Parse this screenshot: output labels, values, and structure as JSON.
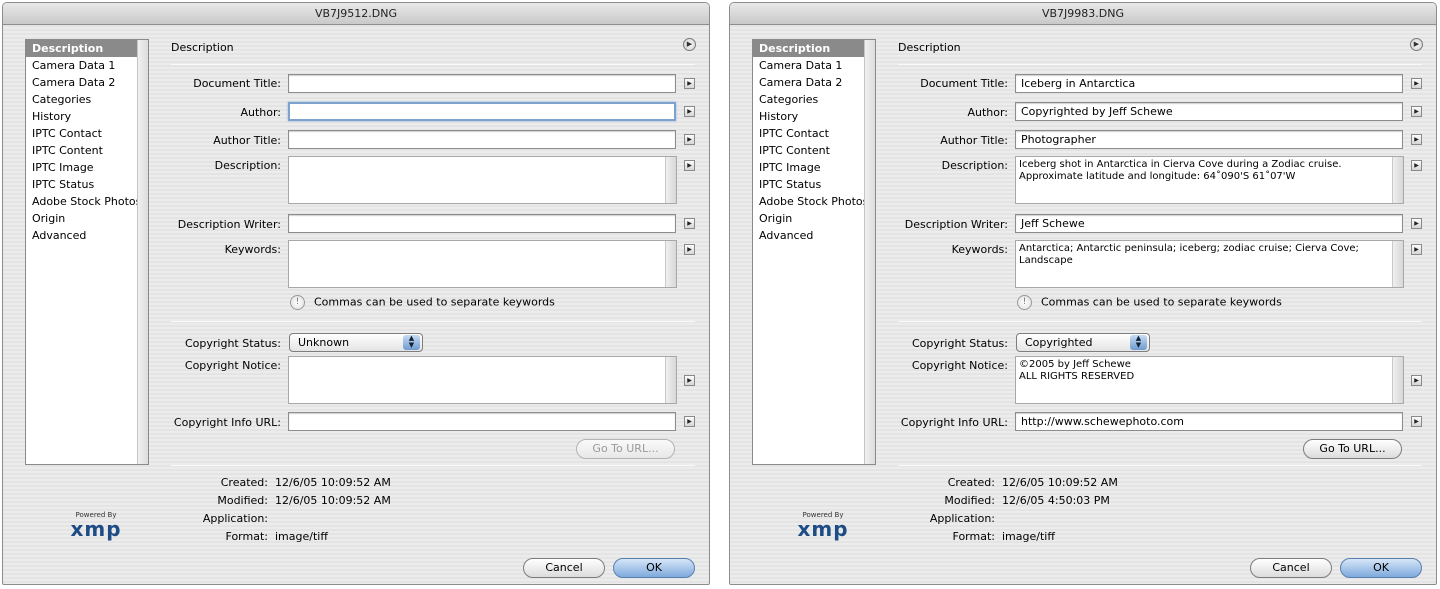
{
  "windows": [
    {
      "title": "VB7J9512.DNG",
      "sidebar": [
        "Description",
        "Camera Data 1",
        "Camera Data 2",
        "Categories",
        "History",
        "IPTC Contact",
        "IPTC Content",
        "IPTC Image",
        "IPTC Status",
        "Adobe Stock Photos",
        "Origin",
        "Advanced"
      ],
      "panel_title": "Description",
      "labels": {
        "document_title": "Document Title:",
        "author": "Author:",
        "author_title": "Author Title:",
        "description": "Description:",
        "description_writer": "Description Writer:",
        "keywords": "Keywords:",
        "copyright_status": "Copyright Status:",
        "copyright_notice": "Copyright Notice:",
        "copyright_url": "Copyright Info URL:"
      },
      "values": {
        "document_title": "",
        "author": "",
        "author_title": "",
        "description_lines": [],
        "description_writer": "",
        "keywords_lines": [],
        "copyright_status": "Unknown",
        "copyright_notice_lines": [],
        "copyright_url": ""
      },
      "keywords_note": "Commas can be used to separate keywords",
      "goto_url_label": "Go To URL...",
      "meta": {
        "created_label": "Created:",
        "created": "12/6/05 10:09:52 AM",
        "modified_label": "Modified:",
        "modified": "12/6/05 10:09:52 AM",
        "application_label": "Application:",
        "application": "",
        "format_label": "Format:",
        "format": "image/tiff"
      },
      "cancel_label": "Cancel",
      "ok_label": "OK",
      "powered_by": "Powered By",
      "xmp_logo": "xmp"
    },
    {
      "title": "VB7J9983.DNG",
      "sidebar": [
        "Description",
        "Camera Data 1",
        "Camera Data 2",
        "Categories",
        "History",
        "IPTC Contact",
        "IPTC Content",
        "IPTC Image",
        "IPTC Status",
        "Adobe Stock Photos",
        "Origin",
        "Advanced"
      ],
      "panel_title": "Description",
      "labels": {
        "document_title": "Document Title:",
        "author": "Author:",
        "author_title": "Author Title:",
        "description": "Description:",
        "description_writer": "Description Writer:",
        "keywords": "Keywords:",
        "copyright_status": "Copyright Status:",
        "copyright_notice": "Copyright Notice:",
        "copyright_url": "Copyright Info URL:"
      },
      "values": {
        "document_title": "Iceberg in Antarctica",
        "author": "Copyrighted by Jeff Schewe",
        "author_title": "Photographer",
        "description_lines": [
          "Iceberg shot in Antarctica in Cierva Cove during a Zodiac cruise.",
          "Approximate latitude and longitude:  64˚090'S 61˚07'W"
        ],
        "description_writer": "Jeff Schewe",
        "keywords_lines": [
          "Antarctica; Antarctic peninsula; iceberg; zodiac cruise; Cierva Cove;",
          "Landscape"
        ],
        "copyright_status": "Copyrighted",
        "copyright_notice_lines": [
          "©2005 by Jeff Schewe",
          "ALL RIGHTS RESERVED"
        ],
        "copyright_url": "http://www.schewephoto.com"
      },
      "keywords_note": "Commas can be used to separate keywords",
      "goto_url_label": "Go To URL...",
      "meta": {
        "created_label": "Created:",
        "created": "12/6/05 10:09:52 AM",
        "modified_label": "Modified:",
        "modified": "12/6/05 4:50:03 PM",
        "application_label": "Application:",
        "application": "",
        "format_label": "Format:",
        "format": "image/tiff"
      },
      "cancel_label": "Cancel",
      "ok_label": "OK",
      "powered_by": "Powered By",
      "xmp_logo": "xmp"
    }
  ]
}
